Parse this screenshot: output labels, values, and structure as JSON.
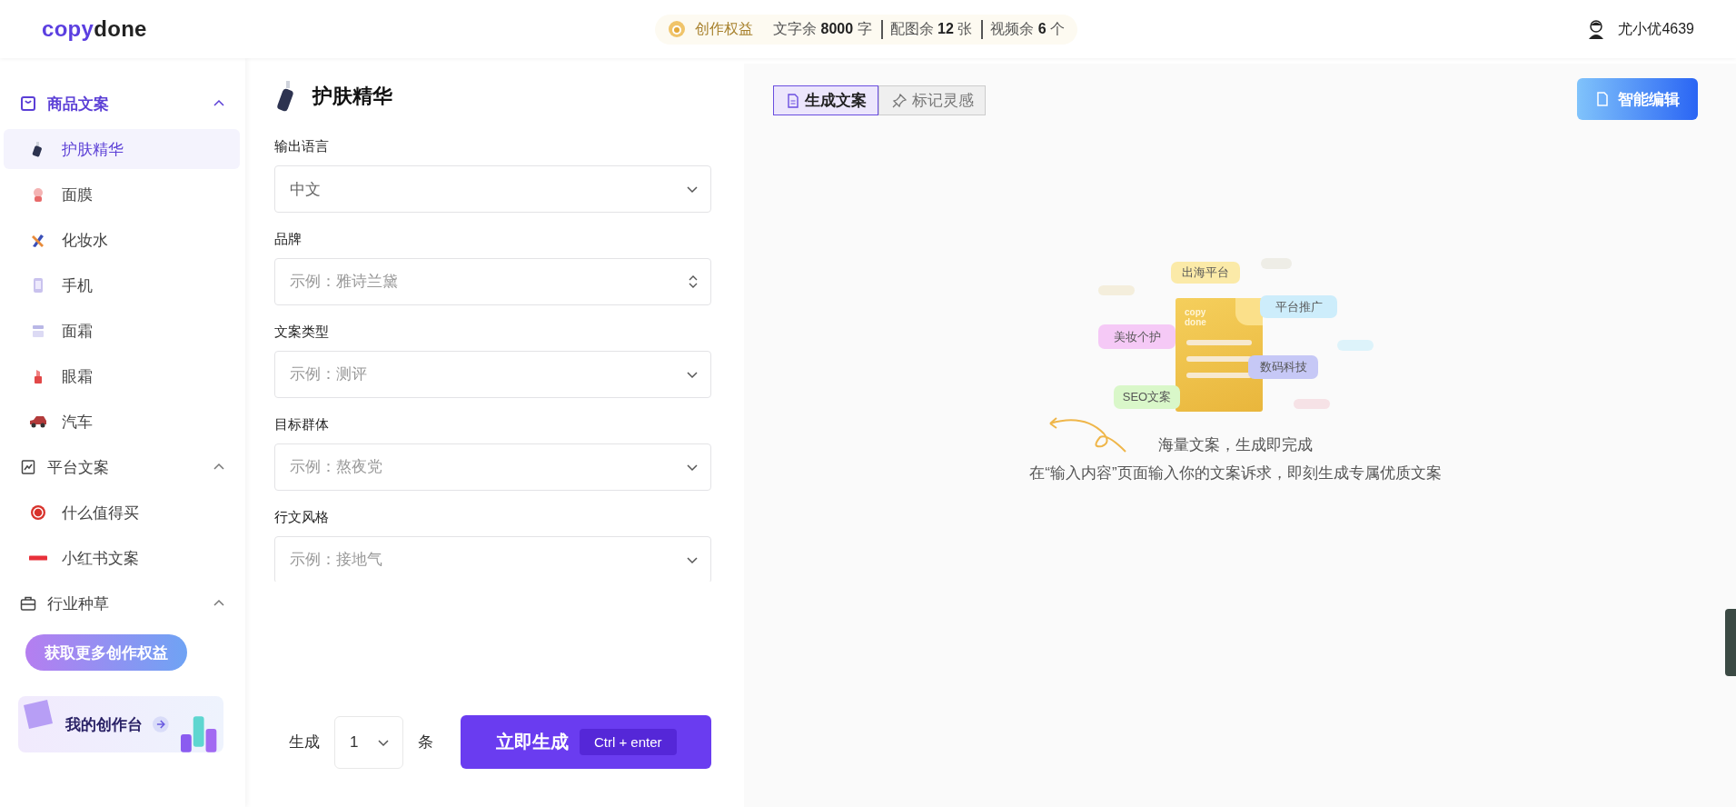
{
  "header": {
    "logo": {
      "accent": "copy",
      "rest": "done"
    },
    "benefit_label": "创作权益",
    "quotas": [
      "文字余 **8000** 字",
      "配图余 **12** 张",
      "视频余 **6** 个"
    ],
    "user_name": "尤小优4639"
  },
  "sidebar": {
    "groups": [
      {
        "title": "商品文案",
        "expanded": true,
        "selected": true,
        "items": [
          {
            "label": "护肤精华",
            "selected": true
          },
          {
            "label": "面膜",
            "selected": false
          },
          {
            "label": "化妆水",
            "selected": false
          },
          {
            "label": "手机",
            "selected": false
          },
          {
            "label": "面霜",
            "selected": false
          },
          {
            "label": "眼霜",
            "selected": false
          },
          {
            "label": "汽车",
            "selected": false
          }
        ]
      },
      {
        "title": "平台文案",
        "expanded": true,
        "selected": false,
        "items": [
          {
            "label": "什么值得买",
            "selected": false
          },
          {
            "label": "小红书文案",
            "selected": false
          }
        ]
      },
      {
        "title": "行业种草",
        "expanded": true,
        "selected": false
      }
    ],
    "promo_button": "获取更多创作权益",
    "workbench_card": "我的创作台"
  },
  "form": {
    "title": "护肤精华",
    "fields": [
      {
        "label": "输出语言",
        "kind": "select",
        "value": "中文"
      },
      {
        "label": "品牌",
        "kind": "number",
        "placeholder": "示例：雅诗兰黛"
      },
      {
        "label": "文案类型",
        "kind": "select",
        "placeholder": "示例：测评"
      },
      {
        "label": "目标群体",
        "kind": "select",
        "placeholder": "示例：熬夜党"
      },
      {
        "label": "行文风格",
        "kind": "select",
        "placeholder": "示例：接地气"
      }
    ],
    "count_label": "生成",
    "count_value": "1",
    "count_unit": "条",
    "generate_button": "立即生成",
    "shortcut": "Ctrl + enter"
  },
  "output": {
    "tabs": [
      {
        "label": "生成文案",
        "selected": true
      },
      {
        "label": "标记灵感",
        "selected": false
      }
    ],
    "smart_edit_button": "智能编辑",
    "illustration": {
      "doc_label": [
        "copy",
        "done"
      ],
      "tags": [
        {
          "label": "出海平台",
          "color": "#fbeaa8"
        },
        {
          "label": "平台推广",
          "color": "#cdedfb"
        },
        {
          "label": "美妆个护",
          "color": "#f5c9f6"
        },
        {
          "label": "数码科技",
          "color": "#c6c8f6"
        },
        {
          "label": "SEO文案",
          "color": "#d9f7c9"
        }
      ]
    },
    "headline": "海量文案，生成即完成",
    "hint": "在“输入内容”页面输入你的文案诉求，即刻生成专属优质文案"
  }
}
